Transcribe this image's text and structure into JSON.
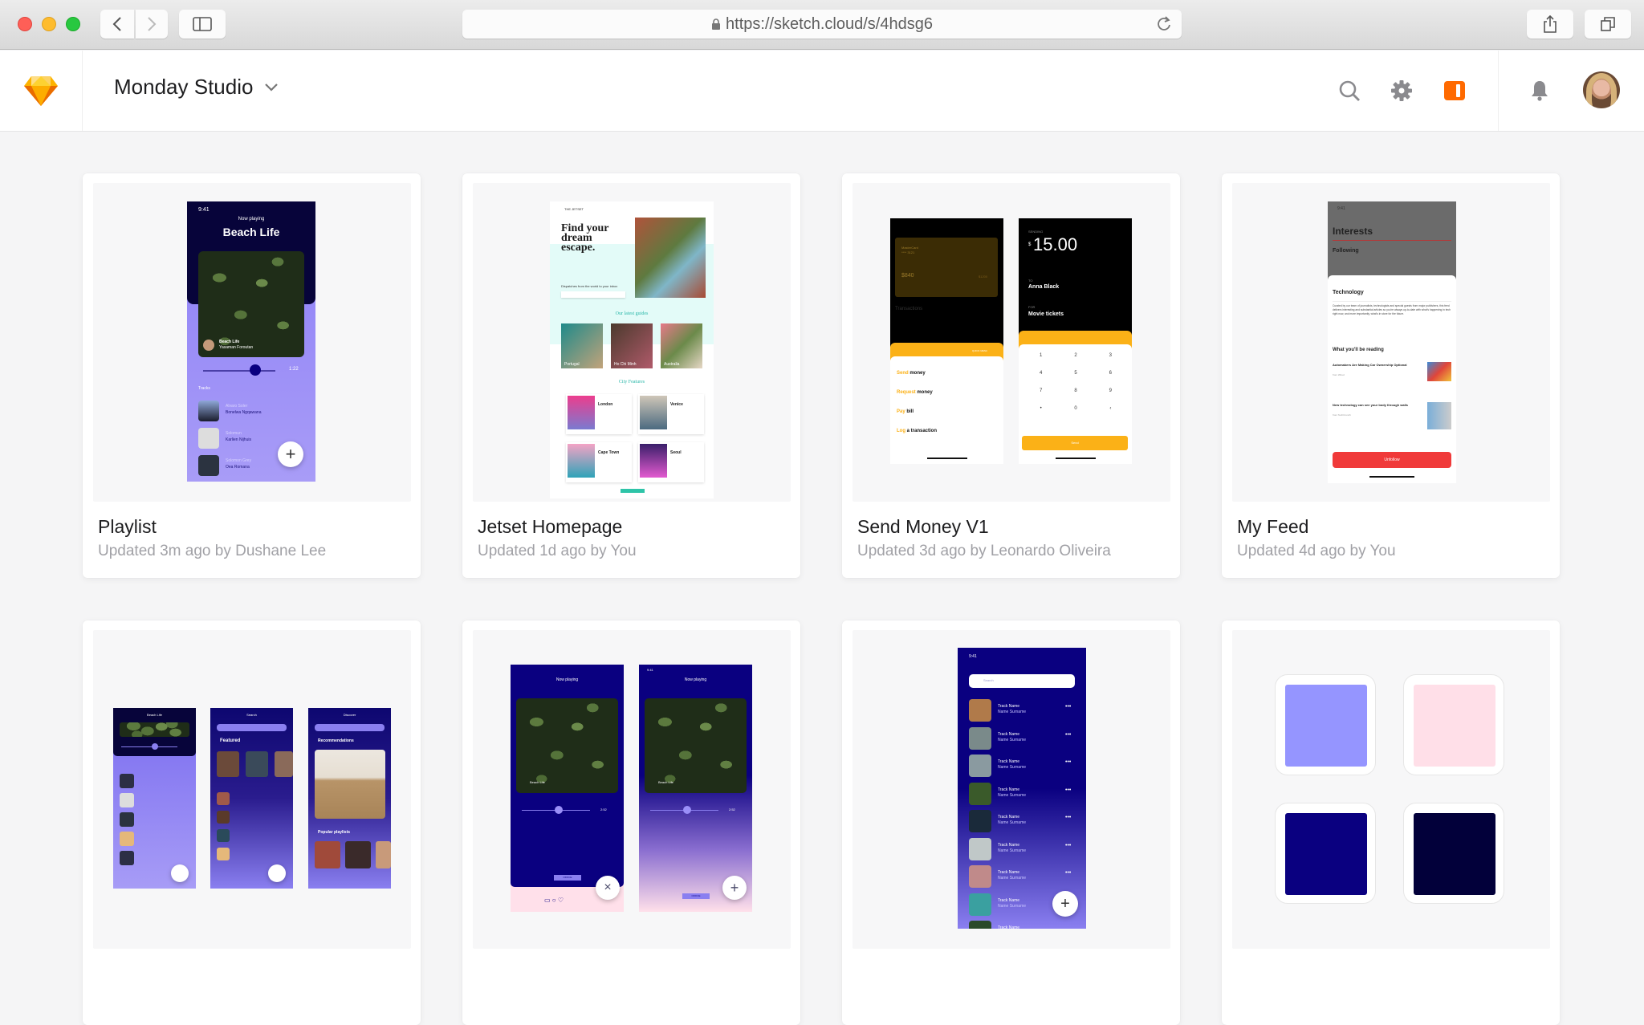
{
  "browser": {
    "url": "https://sketch.cloud/s/4hdsg6",
    "icons": [
      "back-icon",
      "forward-icon",
      "sidebar-icon",
      "lock-icon",
      "reload-icon",
      "share-icon",
      "tabs-icon"
    ]
  },
  "header": {
    "workspace_name": "Monday Studio",
    "icons": [
      "sketch-logo-icon",
      "chevron-down-icon",
      "search-icon",
      "gear-icon",
      "sketch-mirror-icon",
      "bell-icon",
      "avatar"
    ],
    "accent_color": "#ff6a00"
  },
  "documents": [
    {
      "title": "Playlist",
      "meta": "Updated 3m ago by Dushane Lee",
      "preview": {
        "time": "9:41",
        "now_playing": "Now playing",
        "track_title": "Beach Life",
        "artist": "Yasaman Foroutan",
        "elapsed": "1:22",
        "section": "Tracks",
        "tracks": [
          {
            "name": "Alvaro Soler",
            "artist": "Bonelwa Ngqawana"
          },
          {
            "name": "Solomun",
            "artist": "Karlien Nijhuis"
          },
          {
            "name": "Solomon Grey",
            "artist": "Oea Romana"
          }
        ]
      }
    },
    {
      "title": "Jetset Homepage",
      "meta": "Updated 1d ago by You",
      "preview": {
        "brand": "THE JETSET",
        "headline": "Find your dream escape.",
        "subheading": "Dispatches from the world to your inbox",
        "guides_heading": "Our latest guides",
        "guides": [
          "Portugal",
          "Ho Chi Minh",
          "Australia"
        ],
        "city_heading": "City Features",
        "cities": [
          "London",
          "Venice",
          "Cape Town",
          "Seoul"
        ]
      }
    },
    {
      "title": "Send Money V1",
      "meta": "Updated 3d ago by Leonardo Oliveira",
      "preview": {
        "card_name": "MasterCard",
        "card_number": "**** 3121",
        "balance_label": "BALANCE",
        "balance": "$840",
        "limit": "$1200",
        "transactions_label": "Transactions",
        "quick_menu": "QUICK MENU",
        "menu": [
          {
            "verb": "Send",
            "rest": "money"
          },
          {
            "verb": "Request",
            "rest": "money"
          },
          {
            "verb": "Pay",
            "rest": "bill"
          },
          {
            "verb": "Log",
            "rest": "a transaction"
          }
        ],
        "sending_label": "SENDING",
        "currency": "$",
        "amount": "15.00",
        "to_label": "TO",
        "recipient": "Anna Black",
        "for_label": "FOR",
        "purpose": "Movie tickets",
        "keypad": [
          "1",
          "2",
          "3",
          "4",
          "5",
          "6",
          "7",
          "8",
          "9",
          "•",
          "0",
          "‹"
        ],
        "send": "Send"
      }
    },
    {
      "title": "My Feed",
      "meta": "Updated 4d ago by You",
      "preview": {
        "screen_title": "Interests",
        "following": "Following",
        "topic": "Technology",
        "description": "Curated by our team of journalists, technologists and special guests from major publishers, this feed delivers interesting and substantial articles so you're always up-to-date with what's happening in tech right now, and more importantly, what's in store for the future.",
        "reading_heading": "What you'll be reading",
        "articles": [
          {
            "title": "Automakers Are Making Car Ownership Optional",
            "source": "from Wired"
          },
          {
            "title": "New technology can see your body through walls",
            "source": "from TechCrunch"
          }
        ],
        "button": "Unfollow"
      }
    },
    {
      "title": "",
      "meta": "",
      "preview": {
        "screens": [
          "Beach Life",
          "Search",
          "Discover"
        ],
        "featured": "Featured",
        "recommendations": "Recommendations",
        "popular": "Popular playlists"
      }
    },
    {
      "title": "",
      "meta": "",
      "preview": {
        "now_playing": "Now playing",
        "track_title": "Beach Life",
        "elapsed": "2:52",
        "tag": "OFFICE"
      }
    },
    {
      "title": "",
      "meta": "",
      "preview": {
        "time": "9:41",
        "search_placeholder": "Search",
        "track_name": "Track Name",
        "artist_name": "Name Surname",
        "rows": 9
      }
    },
    {
      "title": "",
      "meta": "",
      "preview": {
        "swatches": [
          "#9595ff",
          "#ffdfe8",
          "#0a0080",
          "#02003a"
        ]
      }
    }
  ]
}
